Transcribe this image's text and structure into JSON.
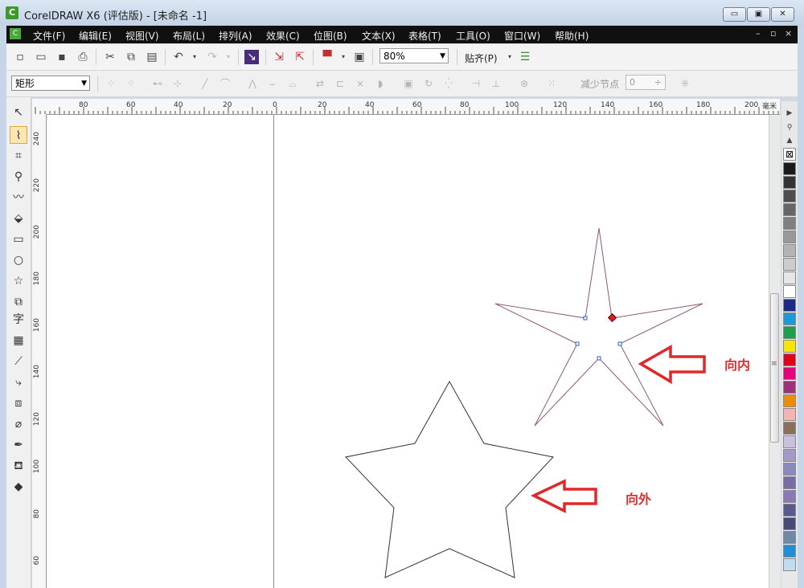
{
  "window": {
    "title": "CorelDRAW X6 (评估版) - [未命名 -1]",
    "app_logo": "C",
    "controls": [
      "▭",
      "▣",
      "✕"
    ]
  },
  "menu": {
    "items": [
      "文件(F)",
      "编辑(E)",
      "视图(V)",
      "布局(L)",
      "排列(A)",
      "效果(C)",
      "位图(B)",
      "文本(X)",
      "表格(T)",
      "工具(O)",
      "窗口(W)",
      "帮助(H)"
    ],
    "doc_controls": [
      "–",
      "▫",
      "×"
    ]
  },
  "toolbar": {
    "zoom": "80%",
    "snap_label": "贴齐(P)"
  },
  "property_bar": {
    "shape_type": "矩形",
    "reduce_nodes_label": "减少节点",
    "reduce_nodes_value": "0"
  },
  "ruler": {
    "h_labels": [
      "80",
      "60",
      "40",
      "20",
      "0",
      "20",
      "40",
      "60",
      "80",
      "100",
      "120",
      "140",
      "160",
      "180",
      "200"
    ],
    "v_labels": [
      "240",
      "220",
      "200",
      "180",
      "160",
      "140",
      "120",
      "100",
      "80",
      "60"
    ],
    "unit": "毫米"
  },
  "annotations": {
    "inward": "向内",
    "outward": "向外"
  },
  "palette_colors": [
    "#1a1a1a",
    "#333333",
    "#4d4d4d",
    "#666666",
    "#808080",
    "#999999",
    "#b3b3b3",
    "#cccccc",
    "#e6e6e6",
    "#ffffff",
    "#1a2b8a",
    "#1b9ad6",
    "#1aa04a",
    "#f5e600",
    "#e2001a",
    "#e6007e",
    "#a0307a",
    "#f08c00",
    "#f4b4b4",
    "#8c6e5a",
    "#c8c0dc",
    "#a898c8",
    "#8a8ac0",
    "#7a6aa8",
    "#8a7ab4",
    "#5a5a90",
    "#4a4a78",
    "#6a8aa8",
    "#1e90d8",
    "#c0dcf0"
  ]
}
